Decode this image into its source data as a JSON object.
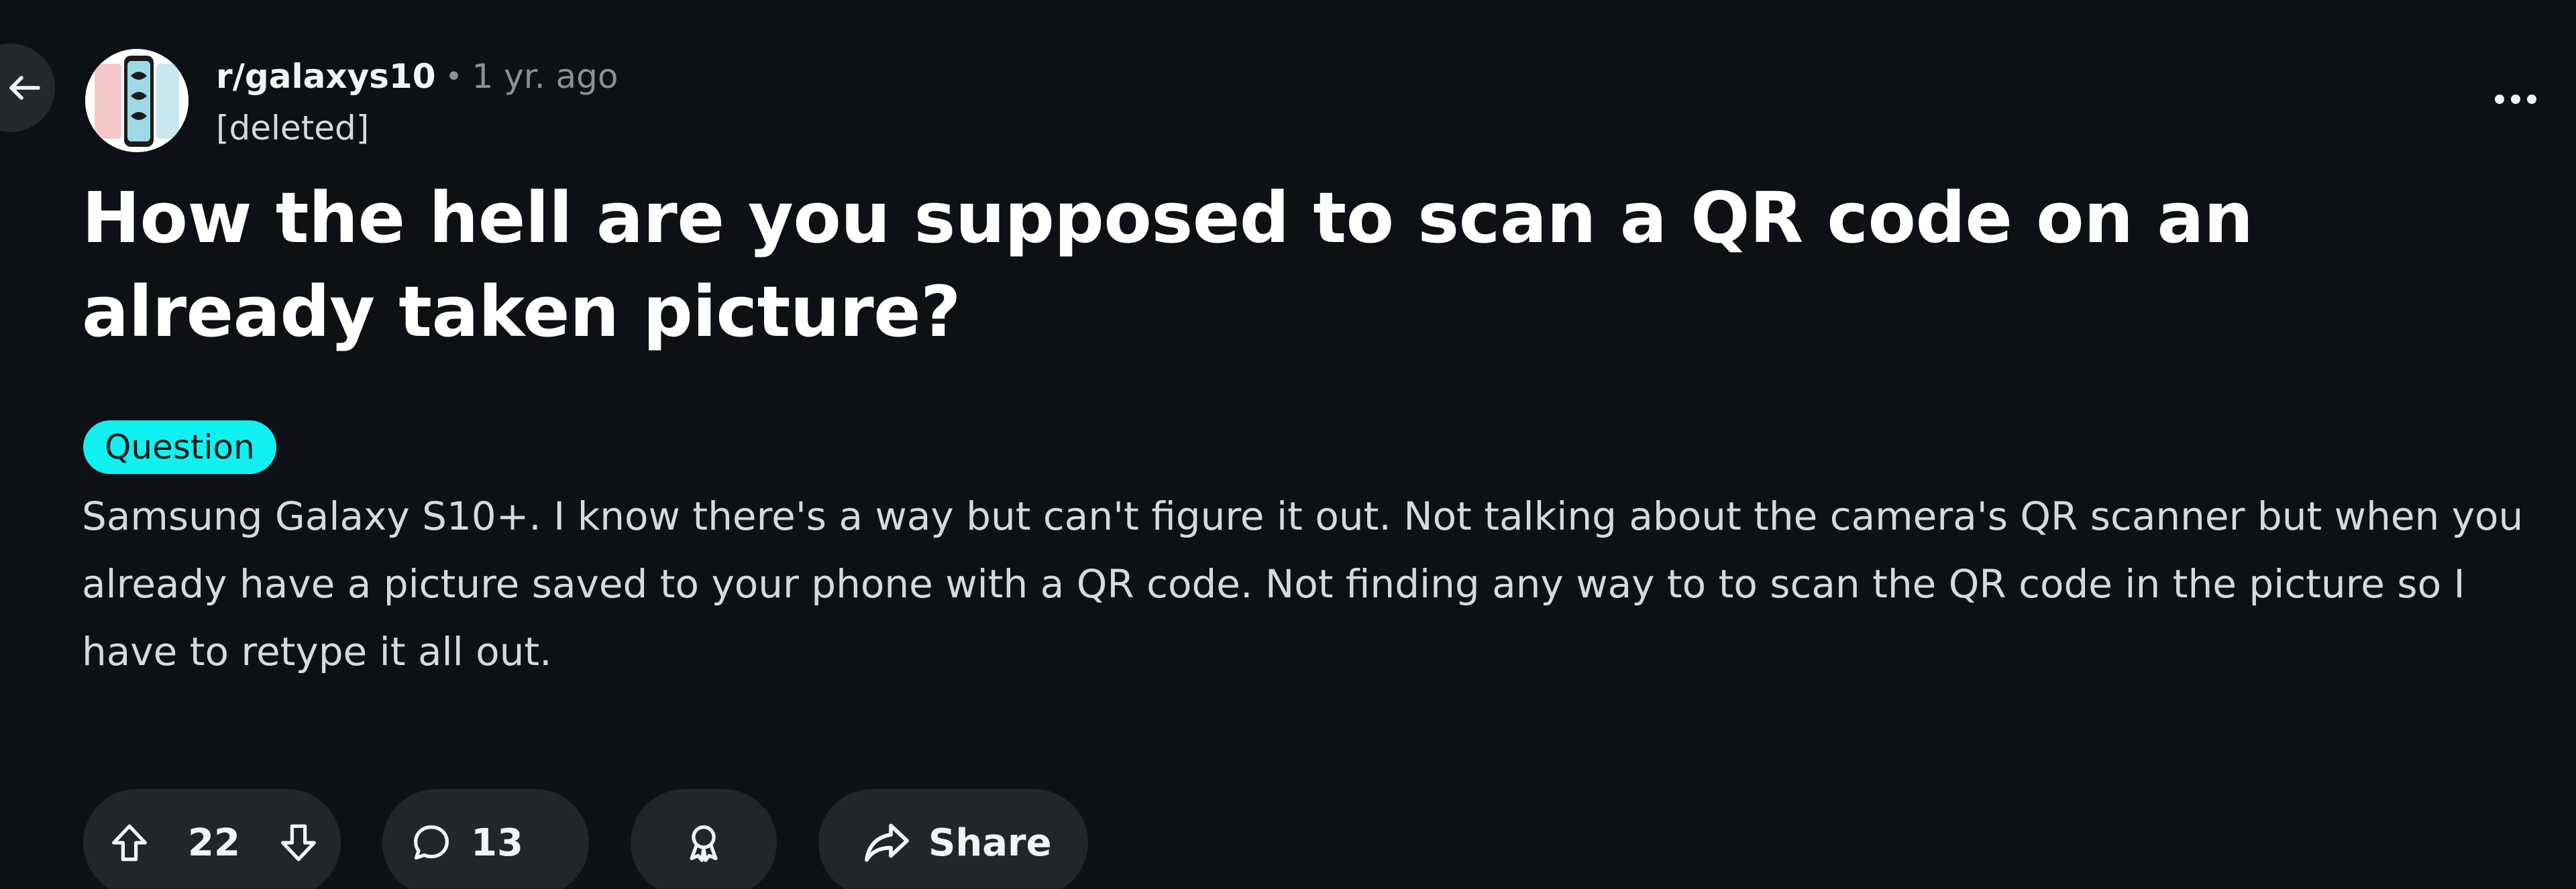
{
  "post": {
    "subreddit": "r/galaxys10",
    "meta_separator": "•",
    "time_ago": "1 yr. ago",
    "author": "[deleted]",
    "title": "How the hell are you supposed to scan a QR code on an already taken picture?",
    "flair": {
      "label": "Question",
      "color": "#0ff1f1"
    },
    "body": "Samsung Galaxy S10+. I know there's a way but can't figure it out. Not talking about the camera's QR scanner but when you already have a picture saved to your phone with a QR code. Not finding any way to to scan the QR code in the picture so I have to retype it all out."
  },
  "actions": {
    "vote_count": "22",
    "comment_count": "13",
    "share_label": "Share"
  },
  "icons": {
    "back": "arrow-left-icon",
    "overflow": "ellipsis-icon",
    "upvote": "arrow-up-icon",
    "downvote": "arrow-down-icon",
    "comments": "speech-bubble-icon",
    "award": "award-ribbon-icon",
    "share": "share-arrow-icon"
  },
  "colors": {
    "background": "#0d1115",
    "pill_background": "#21262b",
    "muted_text": "#8d9196",
    "flair": "#0ff1f1"
  }
}
